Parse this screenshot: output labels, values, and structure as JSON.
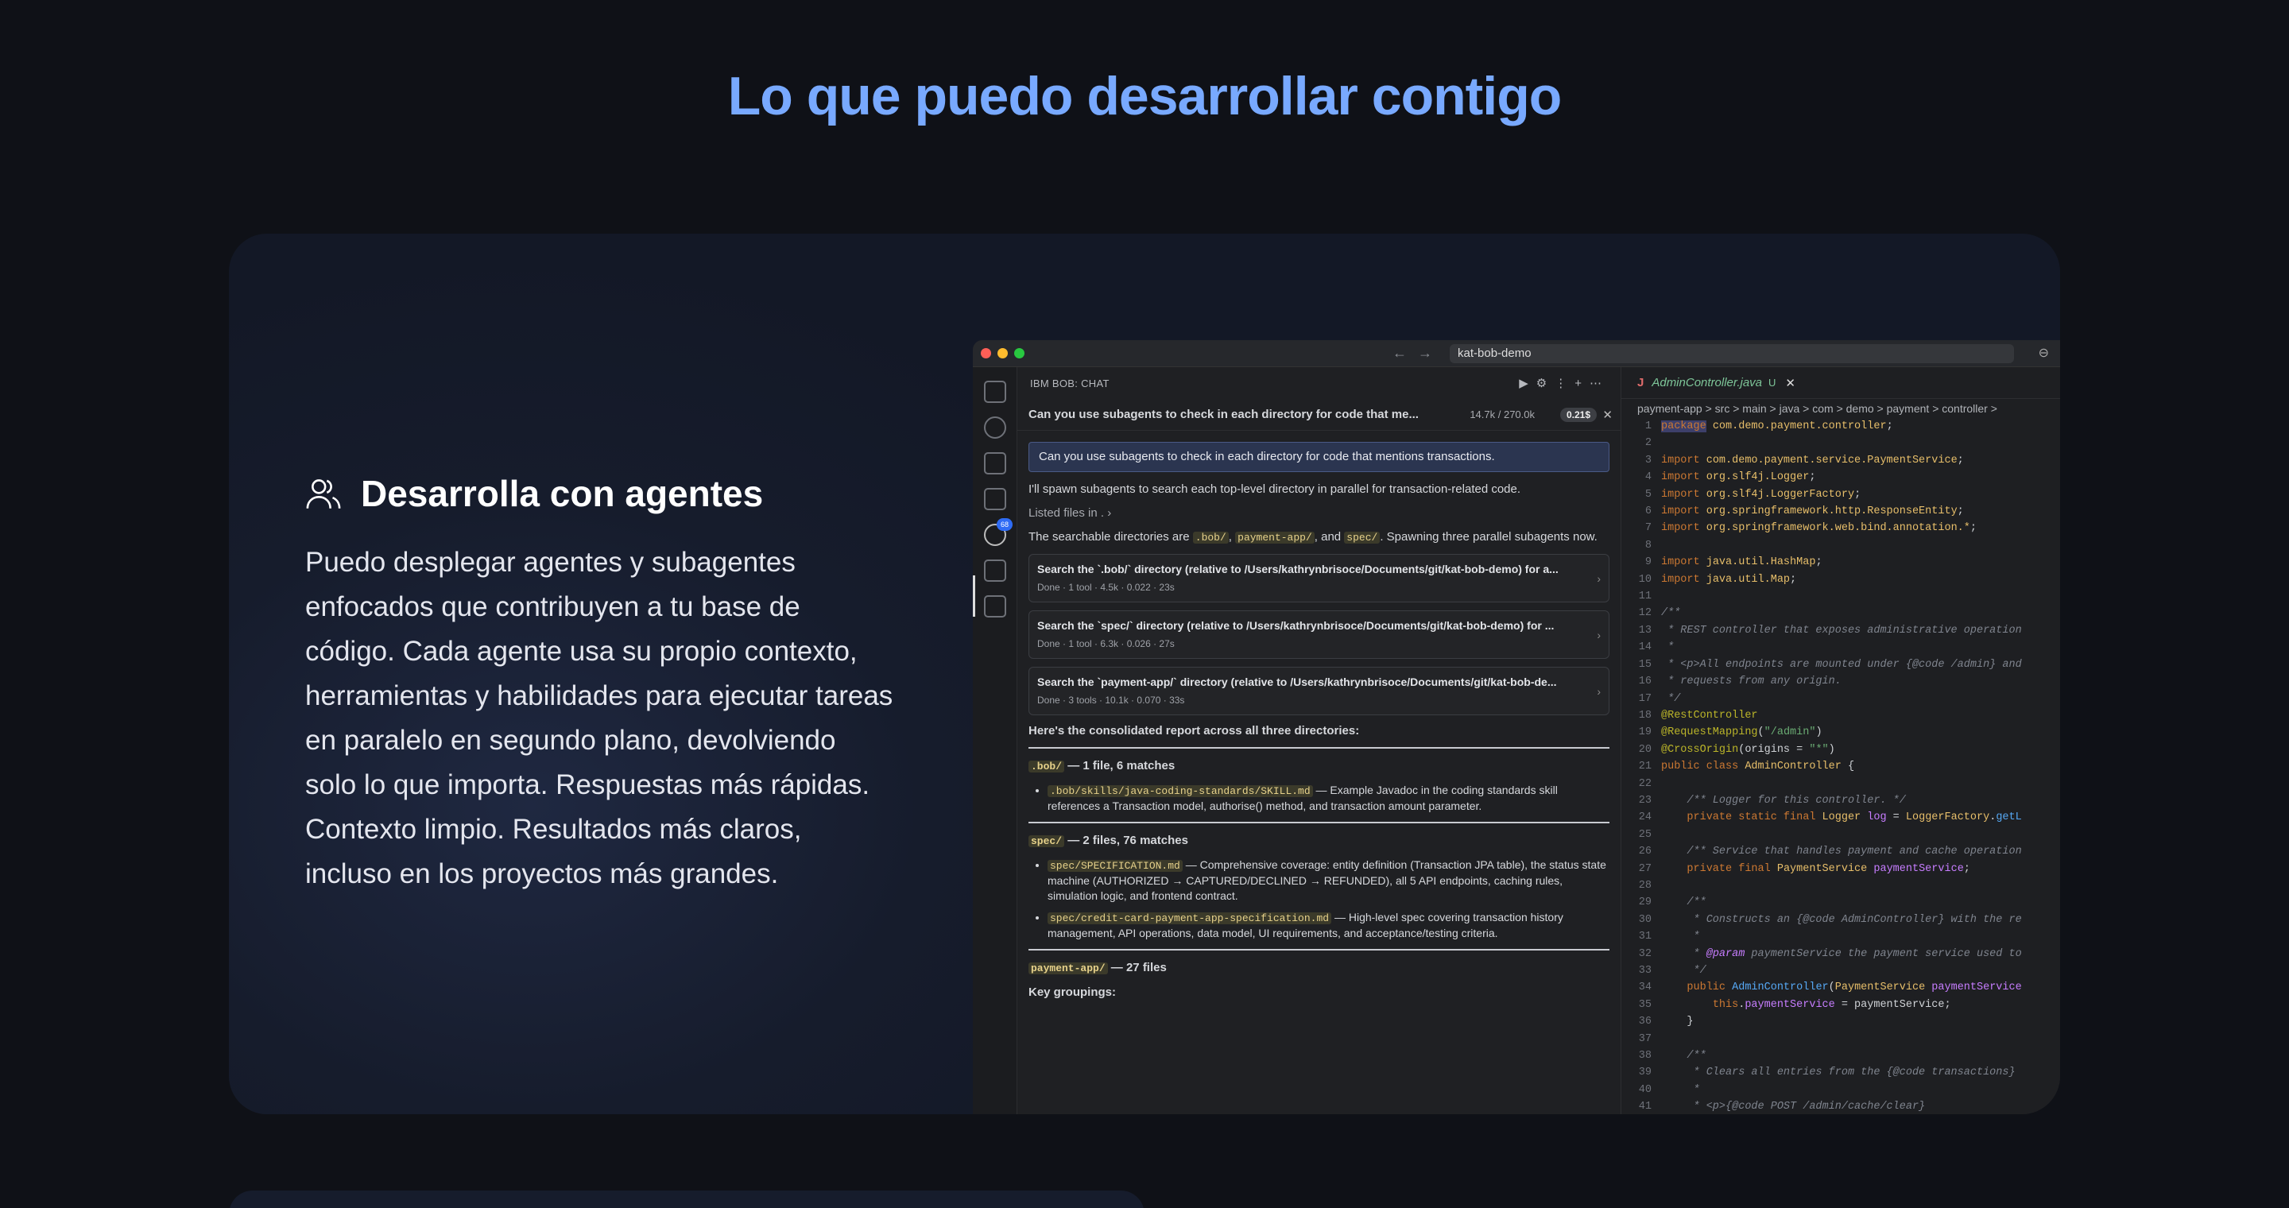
{
  "page": {
    "title": "Lo que puedo desarrollar contigo"
  },
  "feature": {
    "title": "Desarrolla con agentes",
    "icon": "users-icon",
    "description": "Puedo desplegar agentes y subagentes enfocados que contribuyen a tu base de código. Cada agente usa su propio contexto, herramientas y habilidades para ejecutar tareas en paralelo en segundo plano, devolviendo solo lo que importa. Respuestas más rápidas. Contexto limpio. Resultados más claros, incluso en los proyectos más grandes."
  },
  "screenshot": {
    "address": "kat-bob-demo",
    "chat": {
      "header": "IBM BOB: CHAT",
      "task_text": "Can you use subagents to check in each directory for code that me...",
      "task_tokens": "14.7k / 270.0k",
      "task_cost": "0.21$",
      "user_message": "Can you use subagents to check in each directory for code that mentions transactions.",
      "reply_1": "I'll spawn subagents to search each top-level directory in parallel for transaction-related code.",
      "listed": "Listed files in . ›",
      "reply_2_pre": "The searchable directories are",
      "dir_bob": ".bob/",
      "dir_payment": "payment-app/",
      "dir_spec": "spec/",
      "reply_2_post": ". Spawning three parallel subagents now.",
      "subagents": [
        {
          "title": "Search the `.bob/` directory (relative to /Users/kathrynbrisoce/Documents/git/kat-bob-demo) for a...",
          "meta": "Done · 1 tool · 4.5k · 0.022 · 23s"
        },
        {
          "title": "Search the `spec/` directory (relative to /Users/kathrynbrisoce/Documents/git/kat-bob-demo) for ...",
          "meta": "Done · 1 tool · 6.3k · 0.026 · 27s"
        },
        {
          "title": "Search the `payment-app/` directory (relative to /Users/kathrynbrisoce/Documents/git/kat-bob-de...",
          "meta": "Done · 3 tools · 10.1k · 0.070 · 33s"
        }
      ],
      "report_intro": "Here's the consolidated report across all three directories:",
      "sec1_head": "— 1 file, 6 matches",
      "sec1_item": "— Example Javadoc in the coding standards skill references a Transaction model, authorise() method, and transaction amount parameter.",
      "sec1_file": ".bob/skills/java-coding-standards/SKILL.md",
      "sec2_head": "— 2 files, 76 matches",
      "sec2_item1_file": "spec/SPECIFICATION.md",
      "sec2_item1": "— Comprehensive coverage: entity definition (Transaction JPA table), the status state machine (AUTHORIZED → CAPTURED/DECLINED → REFUNDED), all 5 API endpoints, caching rules, simulation logic, and frontend contract.",
      "sec2_item2_file": "spec/credit-card-payment-app-specification.md",
      "sec2_item2": "— High-level spec covering transaction history management, API operations, data model, UI requirements, and acceptance/testing criteria.",
      "sec3_head": "— 27 files",
      "key_groupings": "Key groupings:"
    },
    "editor": {
      "tab_name": "AdminController.java",
      "tab_status": "U",
      "breadcrumb": "payment-app > src > main > java > com > demo > payment > controller >"
    }
  },
  "colors": {
    "accent": "#78a9ff",
    "background": "#0f1117",
    "card": "#161c2c"
  }
}
